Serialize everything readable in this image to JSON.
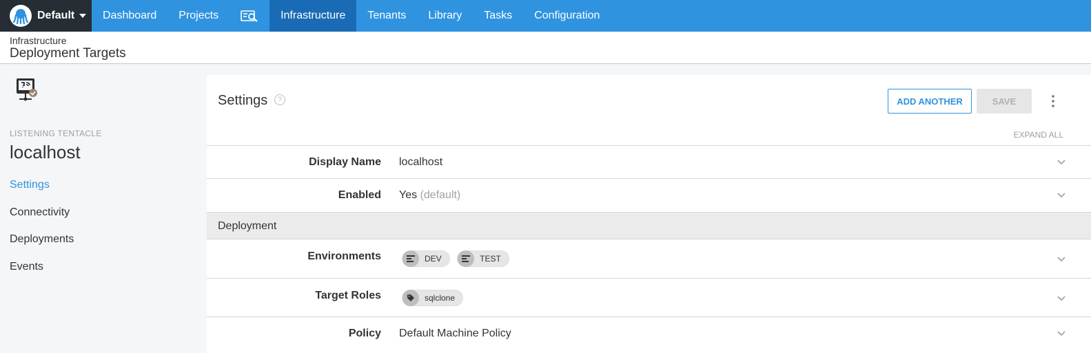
{
  "nav": {
    "space": "Default",
    "items": [
      {
        "label": "Dashboard"
      },
      {
        "label": "Projects"
      },
      {
        "label": "Infrastructure",
        "active": true
      },
      {
        "label": "Tenants"
      },
      {
        "label": "Library"
      },
      {
        "label": "Tasks"
      },
      {
        "label": "Configuration"
      }
    ]
  },
  "header": {
    "breadcrumb": "Infrastructure",
    "title": "Deployment Targets"
  },
  "sidebar": {
    "type": "LISTENING TENTACLE",
    "name": "localhost",
    "links": [
      {
        "label": "Settings",
        "active": true
      },
      {
        "label": "Connectivity"
      },
      {
        "label": "Deployments"
      },
      {
        "label": "Events"
      }
    ]
  },
  "main": {
    "title": "Settings",
    "add_another": "ADD ANOTHER",
    "save": "SAVE",
    "expand_all": "EXPAND ALL",
    "display_name": {
      "label": "Display Name",
      "value": "localhost"
    },
    "enabled": {
      "label": "Enabled",
      "value": "Yes",
      "hint": "(default)"
    },
    "deployment_section": "Deployment",
    "environments": {
      "label": "Environments",
      "chips": [
        "DEV",
        "TEST"
      ]
    },
    "target_roles": {
      "label": "Target Roles",
      "chips": [
        "sqlclone"
      ]
    },
    "policy": {
      "label": "Policy",
      "value": "Default Machine Policy"
    }
  },
  "colors": {
    "nav_bg": "#2f93e0",
    "nav_active": "#1a6bb6",
    "space_bg": "#262d34",
    "link_active": "#2f93e0"
  }
}
